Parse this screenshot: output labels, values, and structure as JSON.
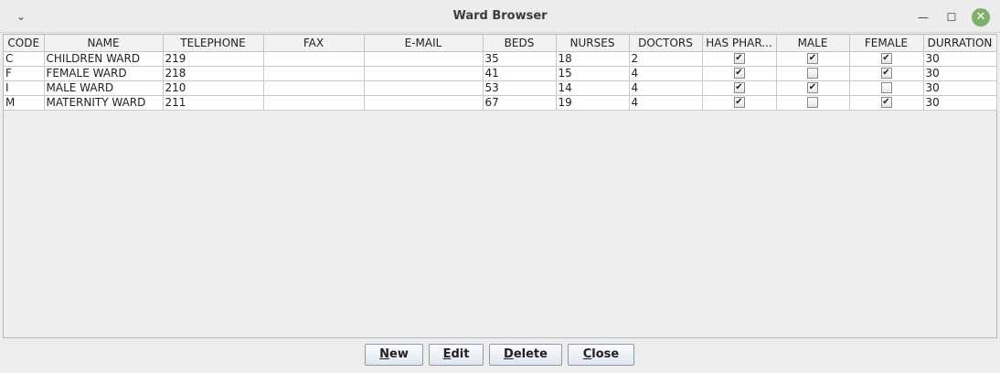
{
  "window": {
    "title": "Ward Browser",
    "menu_glyph": "⌄",
    "min_glyph": "—",
    "max_glyph": "☐",
    "close_glyph": "✕"
  },
  "table": {
    "columns": [
      "CODE",
      "NAME",
      "TELEPHONE",
      "FAX",
      "E-MAIL",
      "BEDS",
      "NURSES",
      "DOCTORS",
      "HAS PHAR...",
      "MALE",
      "FEMALE",
      "DURRATION"
    ],
    "rows": [
      {
        "code": "C",
        "name": "CHILDREN WARD",
        "telephone": "219",
        "fax": "",
        "email": "",
        "beds": "35",
        "nurses": "18",
        "doctors": "2",
        "has_pharmacy": true,
        "male": true,
        "female": true,
        "duration": "30"
      },
      {
        "code": "F",
        "name": "FEMALE WARD",
        "telephone": "218",
        "fax": "",
        "email": "",
        "beds": "41",
        "nurses": "15",
        "doctors": "4",
        "has_pharmacy": true,
        "male": false,
        "female": true,
        "duration": "30"
      },
      {
        "code": "I",
        "name": "MALE WARD",
        "telephone": "210",
        "fax": "",
        "email": "",
        "beds": "53",
        "nurses": "14",
        "doctors": "4",
        "has_pharmacy": true,
        "male": true,
        "female": false,
        "duration": "30"
      },
      {
        "code": "M",
        "name": "MATERNITY WARD",
        "telephone": "211",
        "fax": "",
        "email": "",
        "beds": "67",
        "nurses": "19",
        "doctors": "4",
        "has_pharmacy": true,
        "male": false,
        "female": true,
        "duration": "30"
      }
    ],
    "check_glyph": "✔"
  },
  "buttons": {
    "new": {
      "mnemonic": "N",
      "rest": "ew"
    },
    "edit": {
      "mnemonic": "E",
      "rest": "dit"
    },
    "delete": {
      "mnemonic": "D",
      "rest": "elete"
    },
    "close": {
      "mnemonic": "C",
      "rest": "lose"
    }
  }
}
